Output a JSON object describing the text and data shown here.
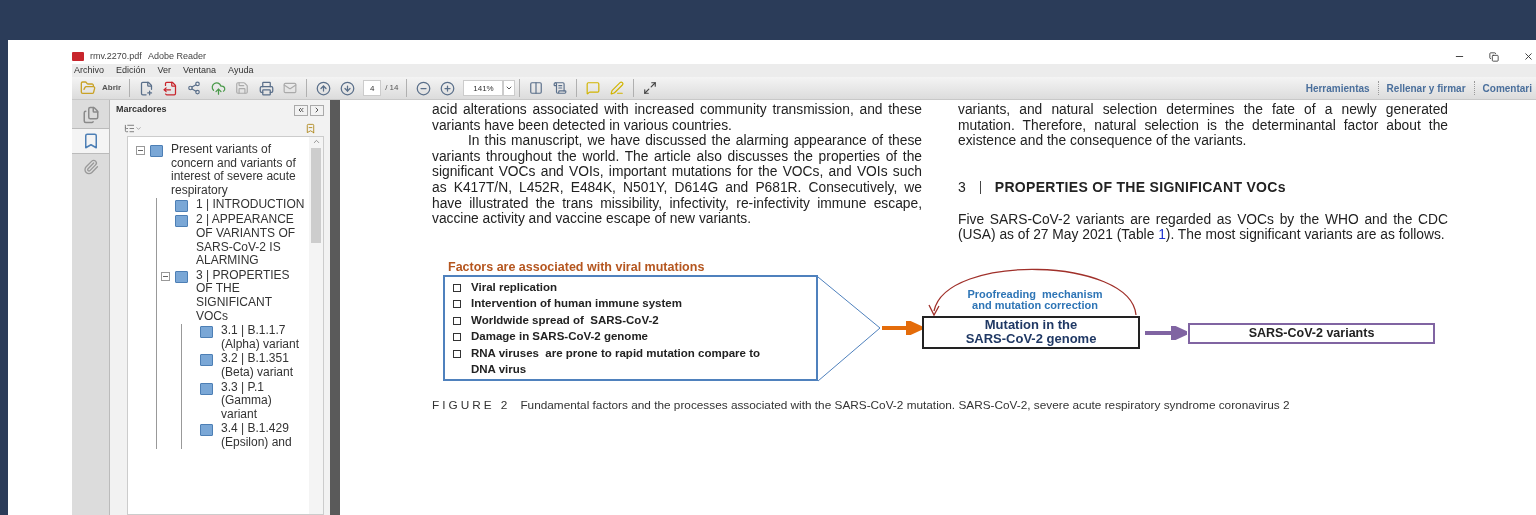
{
  "window": {
    "file": "rmv.2270.pdf",
    "app": "Adobe Reader"
  },
  "menu": [
    "Archivo",
    "Edición",
    "Ver",
    "Ventana",
    "Ayuda"
  ],
  "toolbar": {
    "open_label": "Abrir",
    "page": "4",
    "page_count": "/ 14",
    "zoom": "141%",
    "links": [
      "Herramientas",
      "Rellenar y firmar",
      "Comentari"
    ]
  },
  "side_tabs": [
    {
      "kind": "pages",
      "selected": false
    },
    {
      "kind": "bookmarks",
      "selected": true
    },
    {
      "kind": "attachments",
      "selected": false
    }
  ],
  "bookmarks": {
    "title": "Marcadores",
    "items": [
      {
        "label": "Present variants of concern and variants of interest of severe acute respiratory",
        "expanded": true,
        "children": [
          {
            "label": "1 | INTRODUCTION"
          },
          {
            "label": "2 | APPEARANCE OF VARIANTS OF SARS-CoV-2 IS ALARMING"
          },
          {
            "label": "3 | PROPERTIES OF THE SIGNIFICANT VOCs",
            "expanded": true,
            "children": [
              {
                "label": "3.1 | B.1.1.7 (Alpha) variant"
              },
              {
                "label": "3.2 | B.1.351 (Beta) variant"
              },
              {
                "label": "3.3 | P.1 (Gamma) variant"
              },
              {
                "label": "3.4 | B.1.429 (Epsilon) and"
              }
            ]
          }
        ]
      }
    ]
  },
  "document": {
    "left_paragraphs": [
      {
        "text": "acid alterations associated with increased community transmission, and these variants have been detected in various countries.",
        "indent": false
      },
      {
        "text": "In this manuscript, we have discussed the alarming appearance of these variants throughout the world. The article also discusses the properties of the significant VOCs and VOIs, important mutations for the VOCs, and VOIs such as K417T/N, L452R, E484K, N501Y, D614G and P681R. Consecutively, we have illustrated the trans missibility, infectivity, re-infectivity immune escape, vaccine activity and vaccine escape of new variants.",
        "indent": true
      }
    ],
    "right_paragraph": "variants, and natural selection determines the fate of a newly generated mutation. Therefore, natural selection is the determinantal factor about the existence and the consequence of the variants.",
    "heading": {
      "number": "3",
      "title": "PROPERTIES OF THE SIGNIFICANT VOCs"
    },
    "right_paragraph_2": {
      "before": "Five SARS-CoV-2 variants are regarded as VOCs by the WHO and the CDC (USA) as of 27 May 2021 (Table ",
      "link": "1",
      "after": "). The most significant variants are as follows."
    },
    "figure": {
      "factors_title": "Factors are associated with viral mutations",
      "factors": [
        "Viral replication",
        "Intervention of human immune system",
        "Worldwide spread of  SARS-CoV-2",
        "Damage in SARS-CoV-2 genome",
        "RNA viruses  are prone to rapid mutation compare to  DNA virus"
      ],
      "proofreading": [
        "Proofreading  mechanism",
        "and mutation correction"
      ],
      "mutation": [
        "Mutation in the",
        "SARS-CoV-2 genome"
      ],
      "variants": "SARS-CoV-2 variants"
    },
    "caption": {
      "label": "FIGURE 2",
      "text": "Fundamental factors and the processes associated with the SARS-CoV-2 mutation. SARS-CoV-2, severe acute respiratory syndrome coronavirus 2"
    }
  }
}
